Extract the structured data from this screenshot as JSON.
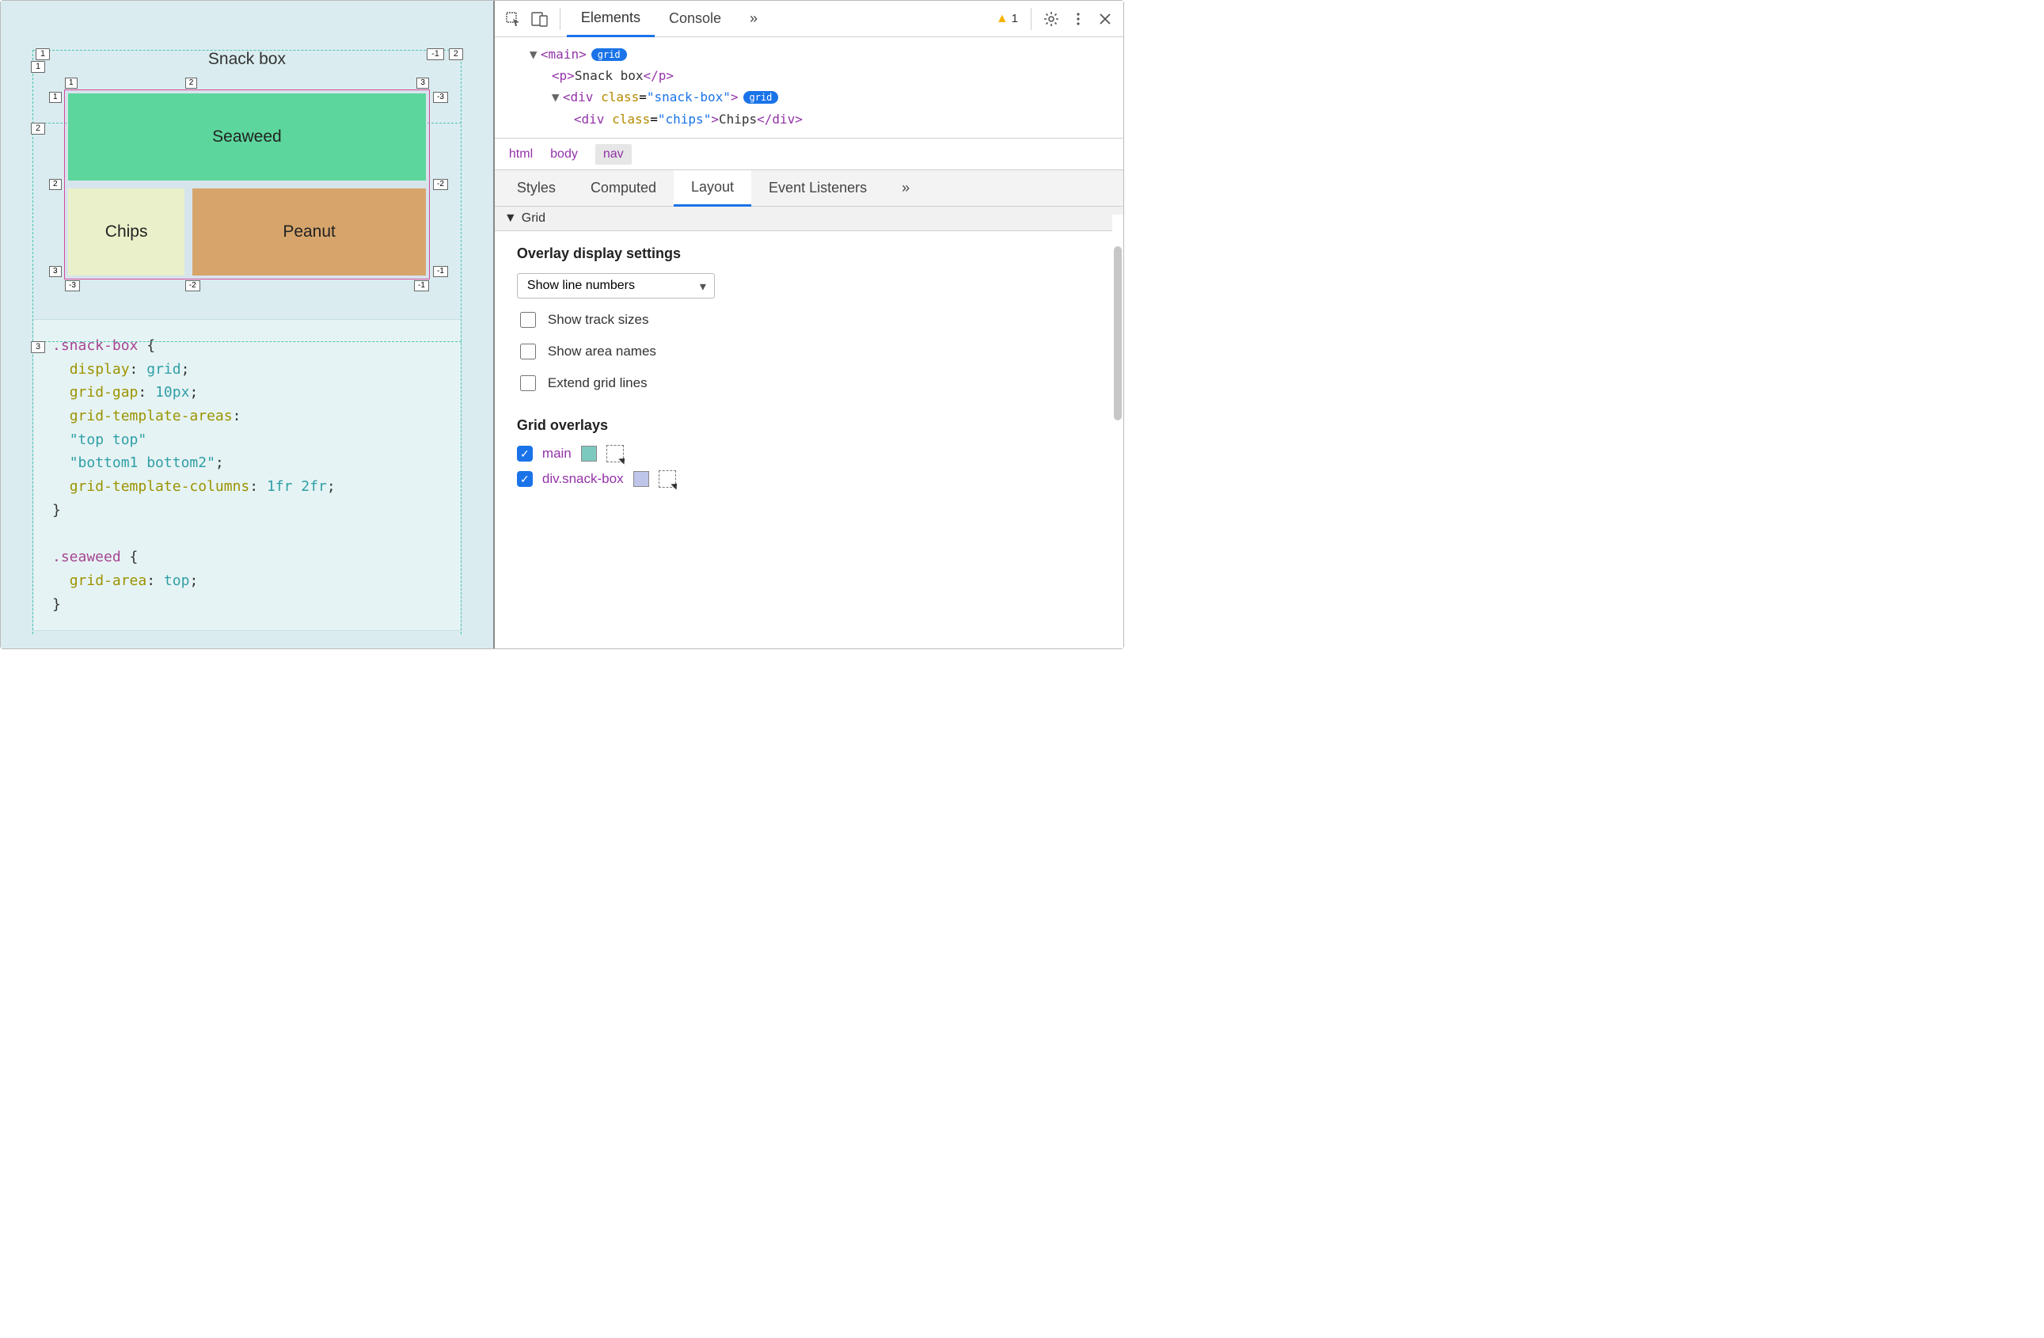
{
  "viewport": {
    "title": "Snack box",
    "cells": {
      "seaweed": "Seaweed",
      "chips": "Chips",
      "peanut": "Peanut"
    },
    "outer_labels": {
      "top": [
        "1",
        "-1"
      ],
      "left": [
        "1",
        "2",
        "3"
      ],
      "corner": "2"
    },
    "inner_labels": {
      "top": [
        "1",
        "2",
        "3"
      ],
      "left": [
        "1",
        "2",
        "3"
      ],
      "right": [
        "-3",
        "-2",
        "-1"
      ],
      "bottom": [
        "-3",
        "-2",
        "-1"
      ]
    },
    "code": ".snack-box {\n  display: grid;\n  grid-gap: 10px;\n  grid-template-areas:\n  \"top top\"\n  \"bottom1 bottom2\";\n  grid-template-columns: 1fr 2fr;\n}\n\n.seaweed {\n  grid-area: top;\n}"
  },
  "devtools": {
    "tabs": [
      "Elements",
      "Console"
    ],
    "more_tabs_glyph": "»",
    "warning_count": "1",
    "dom": {
      "l1": "<main>",
      "l1_badge": "grid",
      "l2": "<p>Snack box</p>",
      "l3": "<div class=\"snack-box\">",
      "l3_badge": "grid",
      "l4": "<div class=\"chips\">Chips</div>"
    },
    "breadcrumb": [
      "html",
      "body",
      "nav"
    ],
    "subtabs": [
      "Styles",
      "Computed",
      "Layout",
      "Event Listeners"
    ],
    "section": "Grid",
    "overlay_section_title": "Overlay display settings",
    "line_mode_selected": "Show line numbers",
    "checks": [
      "Show track sizes",
      "Show area names",
      "Extend grid lines"
    ],
    "overlays_title": "Grid overlays",
    "overlays": [
      {
        "label": "main",
        "swatch": "#7cc9c0"
      },
      {
        "label": "div.snack-box",
        "swatch": "#bfc6ea"
      }
    ]
  }
}
